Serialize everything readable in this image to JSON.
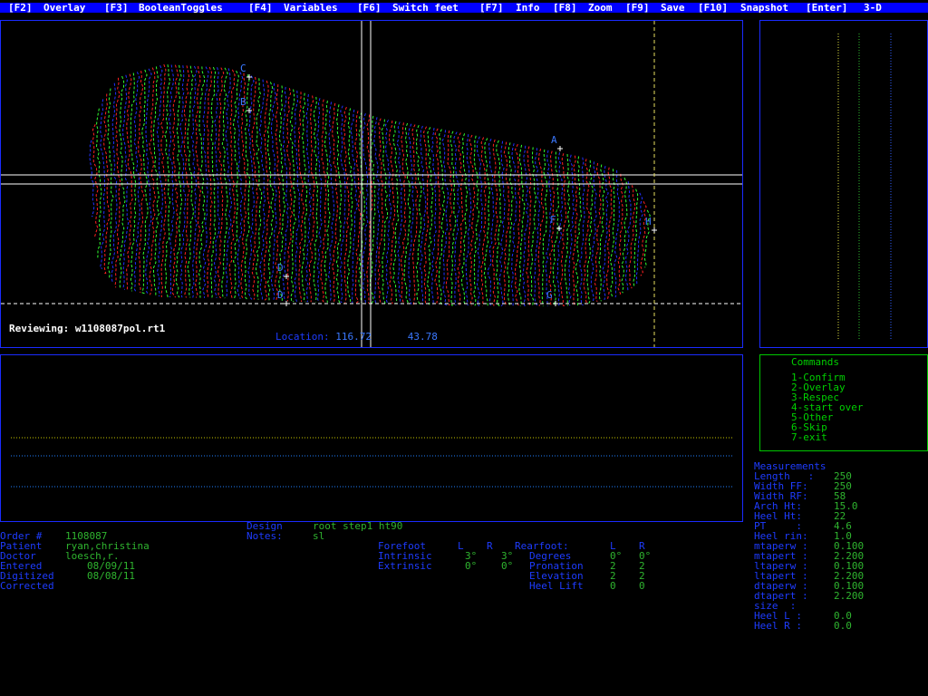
{
  "menu": [
    {
      "key": "[F2]",
      "label": "Overlay"
    },
    {
      "key": "[F3]",
      "label": "BooleanToggles"
    },
    {
      "key": "[F4]",
      "label": "Variables"
    },
    {
      "key": "[F6]",
      "label": "Switch feet"
    },
    {
      "key": "[F7]",
      "label": "Info"
    },
    {
      "key": "[F8]",
      "label": "Zoom"
    },
    {
      "key": "[F9]",
      "label": "Save"
    },
    {
      "key": "[F10]",
      "label": "Snapshot"
    },
    {
      "key": "[Enter]",
      "label": "3-D"
    }
  ],
  "viewer": {
    "reviewing_label": "Reviewing:",
    "reviewing_file": "w1108087pol.rt1",
    "location_label": "Location:",
    "location_x": "116.72",
    "location_y": "43.78",
    "markers": [
      "C",
      "B",
      "A",
      "F",
      "H",
      "D",
      "D",
      "G"
    ]
  },
  "commands": {
    "title": "Commands",
    "items": [
      "1-Confirm",
      "2-Overlay",
      "3-Respec",
      "4-start over",
      "5-Other",
      "6-Skip",
      "7-exit"
    ]
  },
  "measurements": {
    "title": "Measurements",
    "rows": [
      {
        "label": "Length   :",
        "value": "250"
      },
      {
        "label": "Width FF:",
        "value": "250"
      },
      {
        "label": "Width RF:",
        "value": "58"
      },
      {
        "label": "Arch Ht:",
        "value": "15.0"
      },
      {
        "label": "Heel Ht:",
        "value": "22"
      },
      {
        "label": "PT     :",
        "value": "4.6"
      },
      {
        "label": "Heel rin:",
        "value": "1.0"
      },
      {
        "label": "mtaperw :",
        "value": "0.100"
      },
      {
        "label": "mtapert :",
        "value": "2.200"
      },
      {
        "label": "ltaperw :",
        "value": "0.100"
      },
      {
        "label": "ltapert :",
        "value": "2.200"
      },
      {
        "label": "dtaperw :",
        "value": "0.100"
      },
      {
        "label": "dtapert :",
        "value": "2.200"
      },
      {
        "label": "size  :",
        "value": ""
      },
      {
        "label": "Heel L :",
        "value": "0.0"
      },
      {
        "label": "Heel R :",
        "value": "0.0"
      }
    ]
  },
  "order": {
    "rows": [
      {
        "label": "Order #",
        "value": "1108087"
      },
      {
        "label": "Patient",
        "value": "ryan,christina"
      },
      {
        "label": "Doctor",
        "value": "loesch,r."
      },
      {
        "label": "Entered",
        "value": "08/09/11"
      },
      {
        "label": "Digitized",
        "value": "08/08/11"
      },
      {
        "label": "Corrected",
        "value": ""
      }
    ]
  },
  "design": {
    "design_label": "Design",
    "design_value": "root step1 ht90",
    "notes_label": "Notes:",
    "notes_value": "sl"
  },
  "forefoot": {
    "title": "Forefoot",
    "col_l": "L",
    "col_r": "R",
    "rows": [
      {
        "label": "Intrinsic",
        "l": "3°",
        "r": "3°"
      },
      {
        "label": "Extrinsic",
        "l": "0°",
        "r": "0°"
      }
    ]
  },
  "rearfoot": {
    "title": "Rearfoot:",
    "col_l": "L",
    "col_r": "R",
    "rows": [
      {
        "label": "Degrees",
        "l": "0°",
        "r": "0°"
      },
      {
        "label": "Pronation",
        "l": "2",
        "r": "2"
      },
      {
        "label": "Elevation",
        "l": "2",
        "r": "2"
      },
      {
        "label": "Heel Lift",
        "l": "0",
        "r": "0"
      }
    ]
  },
  "colors": {
    "menu_bg": "#0000ff",
    "border_blue": "#1a2bff",
    "label_blue": "#1e3cff",
    "value_green": "#2fb42f",
    "command_green": "#00c800",
    "scan_red": "#ff2020",
    "scan_green": "#30ff30",
    "scan_blue": "#2030ff"
  }
}
